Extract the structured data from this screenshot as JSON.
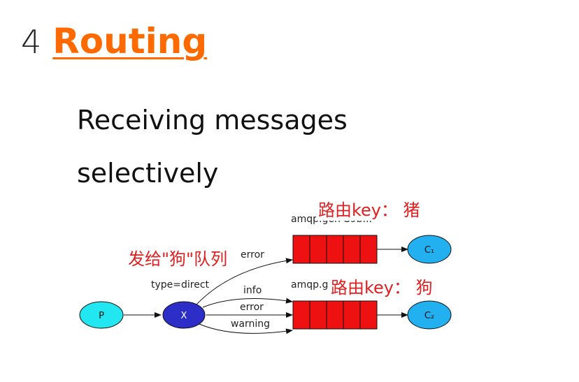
{
  "slide": {
    "number": "4",
    "title": "Routing",
    "subtitle_line1": "Receiving messages",
    "subtitle_line2": "selectively"
  },
  "diagram": {
    "producer": "P",
    "exchange": "X",
    "exchange_type": "type=direct",
    "queue1_name": "amqp.gen-S9b...",
    "queue2_name": "amqp.g",
    "consumer1": "C₁",
    "consumer2": "C₂",
    "binding_q1": "error",
    "binding_q2_a": "info",
    "binding_q2_b": "error",
    "binding_q2_c": "warning",
    "colors": {
      "producer_fill": "#22e6f0",
      "exchange_fill": "#2d2ec8",
      "queue_fill": "#ee1111",
      "consumer_fill": "#22b0f0"
    }
  },
  "annotations": {
    "send_to_dog": "发给\"狗\"队列",
    "routing_key_pig": "路由key： 猪",
    "routing_key_dog": "路由key： 狗"
  }
}
